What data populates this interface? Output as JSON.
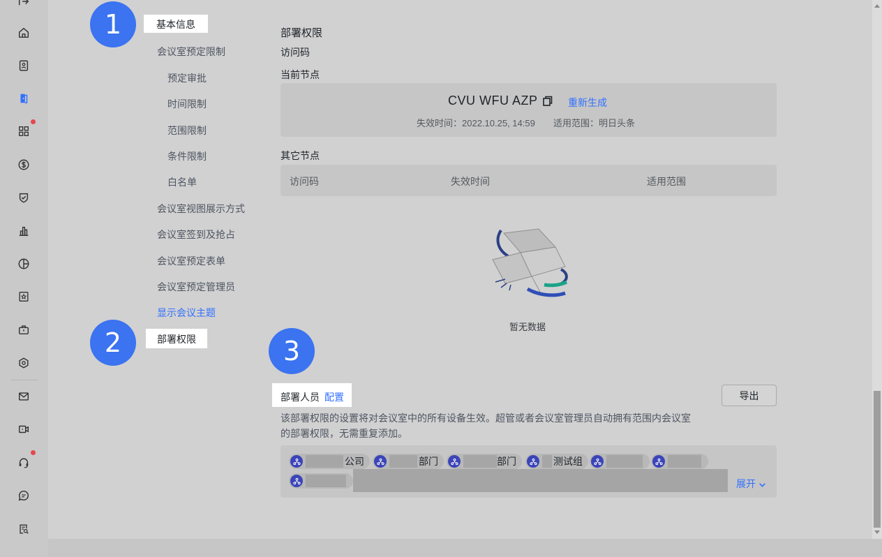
{
  "rail": {
    "icons": [
      "home-icon",
      "contacts-icon",
      "meeting-room-icon",
      "apps-icon",
      "billing-icon",
      "shield-check-icon",
      "bar-chart-icon",
      "pie-chart-icon",
      "badge-star-icon",
      "toolbox-icon",
      "settings-hex-icon",
      "mail-icon",
      "video-icon",
      "headset-icon",
      "chat-icon",
      "form-search-icon"
    ]
  },
  "badges": {
    "one": "1",
    "two": "2",
    "three": "3"
  },
  "nav": {
    "basic_info": "基本信息",
    "booking_limits": "会议室预定限制",
    "booking_approval": "预定审批",
    "time_limit": "时间限制",
    "scope_limit": "范围限制",
    "condition_limit": "条件限制",
    "whitelist": "白名单",
    "view_display": "会议室视图展示方式",
    "checkin": "会议室签到及抢占",
    "booking_form": "会议室预定表单",
    "booking_admin": "会议室预定管理员",
    "show_topic": "显示会议主题",
    "deploy_permission": "部署权限"
  },
  "deploy": {
    "title": "部署权限",
    "access_code_label": "访问码",
    "current_node_label": "当前节点",
    "code": "CVU WFU AZP",
    "regenerate": "重新生成",
    "expiry": "失效时间：2022.10.25, 14:59",
    "scope": "适用范围：明日头条",
    "other_nodes_label": "其它节点",
    "columns": [
      "访问码",
      "失效时间",
      "适用范围"
    ],
    "empty_text": "暂无数据"
  },
  "members": {
    "label": "部署人员",
    "configure": "配置",
    "export": "导出",
    "desc_line1": "该部署权限的设置将对会议室中的所有设备生效。超管或者会议室管理员自动拥有范围内会议室",
    "desc_line2": "的部署权限，无需重复添加。",
    "chips": [
      "公司",
      "部门",
      "部门",
      "测试组",
      "",
      "",
      ""
    ],
    "expand": "展开"
  }
}
